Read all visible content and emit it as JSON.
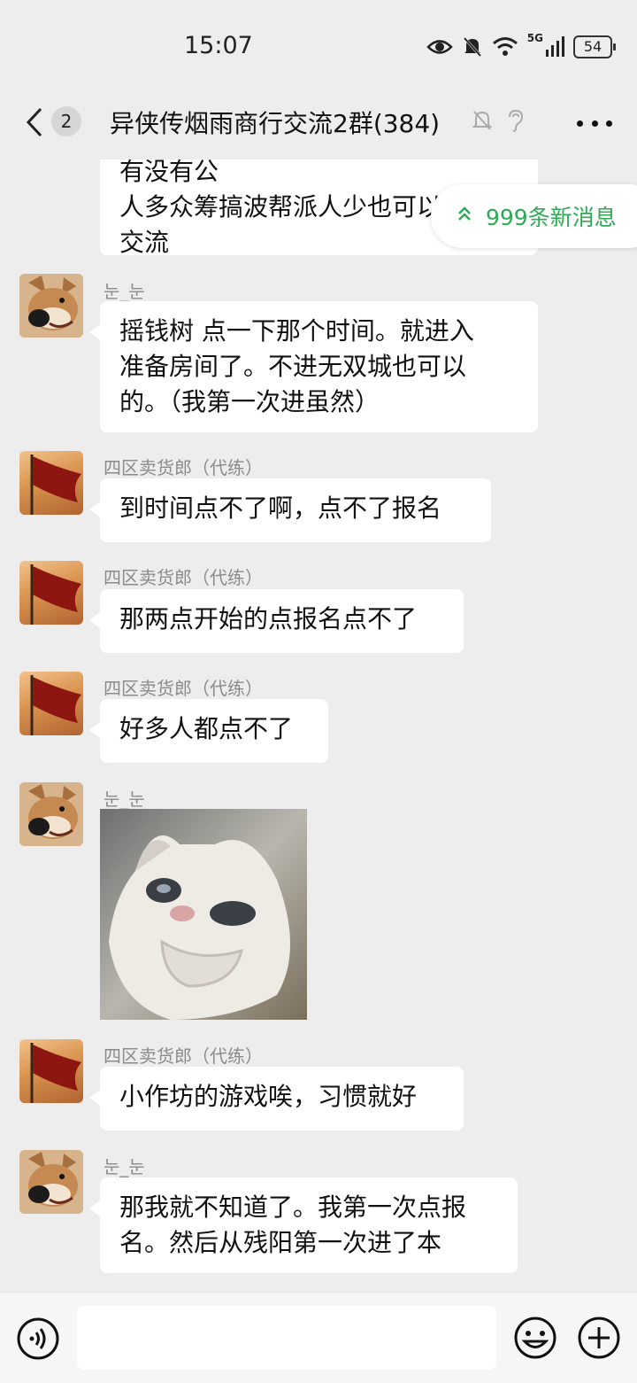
{
  "status_bar": {
    "time": "15:07",
    "network": "5G",
    "battery": "54"
  },
  "header": {
    "unread_count": "2",
    "title": "异侠传烟雨商行交流2群(384)"
  },
  "new_messages": {
    "label": "999条新消息"
  },
  "messages": [
    {
      "sender": "",
      "avatar": "cut",
      "lines": [
        "有没有公",
        "人多众筹搞波帮派人少也可以一起",
        "交流"
      ]
    },
    {
      "sender": "눈_눈",
      "avatar": "dog-icon",
      "lines": [
        "摇钱树 点一下那个时间。就进入",
        "准备房间了。不进无双城也可以",
        "的。（我第一次进虽然）"
      ]
    },
    {
      "sender": "四区卖货郎（代练）",
      "avatar": "flag-icon",
      "lines": [
        "到时间点不了啊，点不了报名"
      ]
    },
    {
      "sender": "四区卖货郎（代练）",
      "avatar": "flag-icon",
      "lines": [
        "那两点开始的点报名点不了"
      ]
    },
    {
      "sender": "四区卖货郎（代练）",
      "avatar": "flag-icon",
      "lines": [
        "好多人都点不了"
      ]
    },
    {
      "sender": "눈_눈",
      "avatar": "dog-icon",
      "lines": [],
      "sticker": "crying-cat-sticker"
    },
    {
      "sender": "四区卖货郎（代练）",
      "avatar": "flag-icon",
      "lines": [
        "小作坊的游戏唉，习惯就好"
      ]
    },
    {
      "sender": "눈_눈",
      "avatar": "dog-icon",
      "lines": [
        "那我就不知道了。我第一次点报",
        "名。然后从残阳第一次进了本"
      ]
    }
  ],
  "input": {
    "placeholder": ""
  },
  "colors": {
    "background": "#ededed",
    "bubble": "#ffffff",
    "accent_green": "#2fa956",
    "sender_gray": "#8b8b8b"
  }
}
